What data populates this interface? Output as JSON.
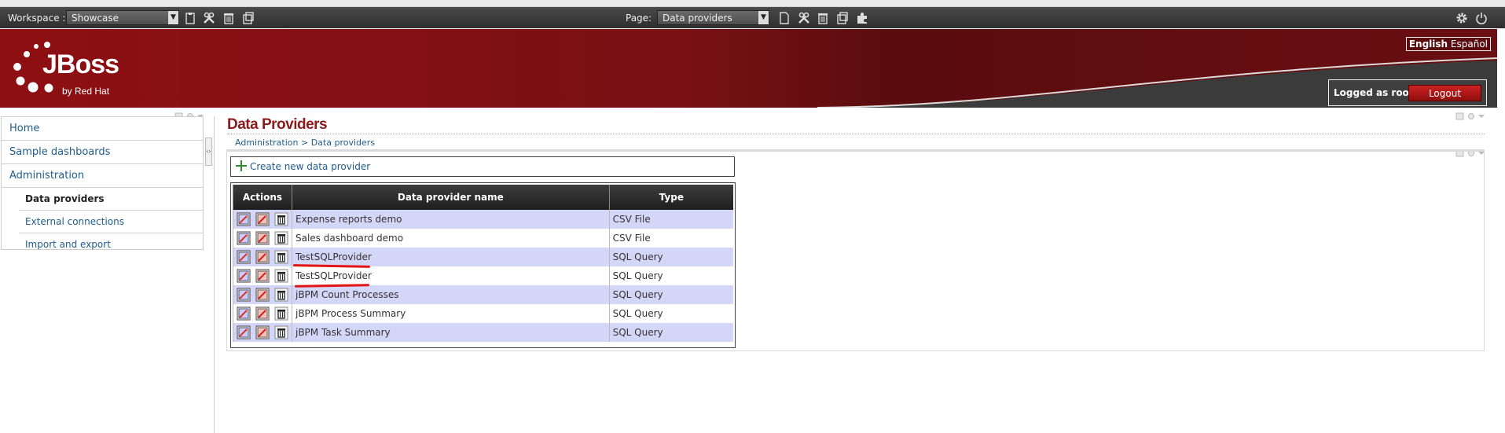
{
  "toolbar": {
    "workspace_label": "Workspace :",
    "workspace_value": "Showcase",
    "page_label": "Page:",
    "page_value": "Data providers"
  },
  "header": {
    "logo_text": "JBoss",
    "logo_sub": "by Red Hat",
    "lang_active": "English",
    "lang_other": "Español",
    "logged_as": "Logged as root",
    "logout_label": "Logout"
  },
  "sidebar": {
    "items": [
      {
        "label": "Home"
      },
      {
        "label": "Sample dashboards"
      },
      {
        "label": "Administration"
      },
      {
        "label": "Data providers"
      },
      {
        "label": "External connections"
      },
      {
        "label": "Import and export"
      }
    ]
  },
  "main": {
    "title": "Data Providers",
    "breadcrumb": "Administration > Data providers",
    "create_label": "Create new data provider",
    "table": {
      "headers": [
        "Actions",
        "Data provider name",
        "Type"
      ],
      "rows": [
        {
          "name": "Expense reports demo",
          "type": "CSV File"
        },
        {
          "name": "Sales dashboard demo",
          "type": "CSV File"
        },
        {
          "name": "TestSQLProvider",
          "type": "SQL Query"
        },
        {
          "name": "TestSQLProvider",
          "type": "SQL Query"
        },
        {
          "name": "jBPM Count Processes",
          "type": "SQL Query"
        },
        {
          "name": "jBPM Process Summary",
          "type": "SQL Query"
        },
        {
          "name": "jBPM Task Summary",
          "type": "SQL Query"
        }
      ]
    }
  },
  "colors": {
    "header_red": "#8e0f12",
    "title_red": "#8b1c1c",
    "link_blue": "#1f5d8e",
    "row_alt": "#d4d6f8"
  }
}
